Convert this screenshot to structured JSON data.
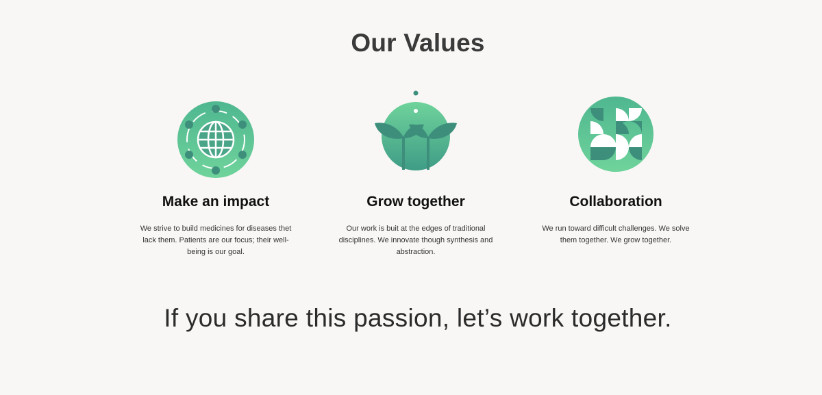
{
  "section": {
    "title": "Our Values"
  },
  "values": [
    {
      "icon": "globe-icon",
      "title": "Make an impact",
      "text": "We strive to build medicines for diseases thet lack them. Patients are our focus; their well-being is our goal."
    },
    {
      "icon": "sprout-icon",
      "title": "Grow together",
      "text": "Our work is buit at the edges of traditional disciplines. We innovate though synthesis and abstraction."
    },
    {
      "icon": "pinwheel-icon",
      "title": "Collaboration",
      "text": "We run toward difficult challenges. We solve them together.  We grow together."
    }
  ],
  "cta": {
    "text": "If you share this passion, let’s work together."
  },
  "colors": {
    "background": "#f8f7f5",
    "green_light": "#6fd39b",
    "green_dark": "#3d9a83",
    "title_text": "#3a3a3a"
  }
}
